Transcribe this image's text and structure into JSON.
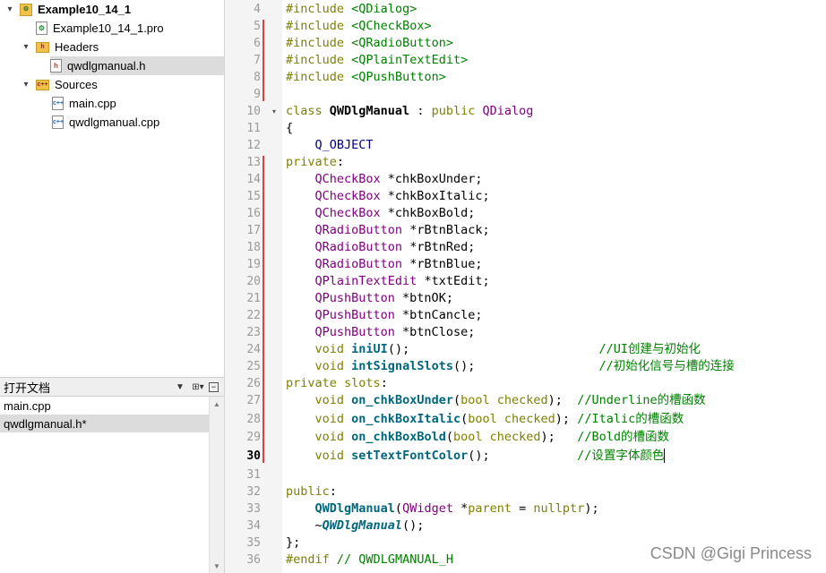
{
  "project_tree": {
    "items": [
      {
        "label": "Example10_14_1",
        "kind": "project",
        "expanded": true
      },
      {
        "label": "Example10_14_1.pro",
        "kind": "pro"
      },
      {
        "label": "Headers",
        "kind": "folder",
        "badge": "h",
        "expanded": true
      },
      {
        "label": "qwdlgmanual.h",
        "kind": "h",
        "selected": true
      },
      {
        "label": "Sources",
        "kind": "folder",
        "badge": "c++",
        "expanded": true
      },
      {
        "label": "main.cpp",
        "kind": "cpp"
      },
      {
        "label": "qwdlgmanual.cpp",
        "kind": "cpp"
      }
    ]
  },
  "open_documents": {
    "title": "打开文档",
    "icon_filter": "combo-arrow-icon",
    "icon_split": "split-icon",
    "icon_close": "close-icon",
    "items": [
      "main.cpp",
      "qwdlgmanual.h*"
    ],
    "selected_index": 1
  },
  "editor": {
    "current_line": 30,
    "lines": [
      {
        "n": 4,
        "code": "#include <QDialog>"
      },
      {
        "n": 5,
        "code": "#include <QCheckBox>"
      },
      {
        "n": 6,
        "code": "#include <QRadioButton>"
      },
      {
        "n": 7,
        "code": "#include <QPlainTextEdit>"
      },
      {
        "n": 8,
        "code": "#include <QPushButton>"
      },
      {
        "n": 9,
        "code": ""
      },
      {
        "n": 10,
        "code": "class QWDlgManual : public QDialog"
      },
      {
        "n": 11,
        "code": "{"
      },
      {
        "n": 12,
        "code": "    Q_OBJECT"
      },
      {
        "n": 13,
        "code": "private:"
      },
      {
        "n": 14,
        "code": "    QCheckBox *chkBoxUnder;"
      },
      {
        "n": 15,
        "code": "    QCheckBox *chkBoxItalic;"
      },
      {
        "n": 16,
        "code": "    QCheckBox *chkBoxBold;"
      },
      {
        "n": 17,
        "code": "    QRadioButton *rBtnBlack;"
      },
      {
        "n": 18,
        "code": "    QRadioButton *rBtnRed;"
      },
      {
        "n": 19,
        "code": "    QRadioButton *rBtnBlue;"
      },
      {
        "n": 20,
        "code": "    QPlainTextEdit *txtEdit;"
      },
      {
        "n": 21,
        "code": "    QPushButton *btnOK;"
      },
      {
        "n": 22,
        "code": "    QPushButton *btnCancle;"
      },
      {
        "n": 23,
        "code": "    QPushButton *btnClose;"
      },
      {
        "n": 24,
        "code": "    void iniUI();                          //UI创建与初始化"
      },
      {
        "n": 25,
        "code": "    void intSignalSlots();                 //初始化信号与槽的连接"
      },
      {
        "n": 26,
        "code": "private slots:"
      },
      {
        "n": 27,
        "code": "    void on_chkBoxUnder(bool checked);  //Underline的槽函数"
      },
      {
        "n": 28,
        "code": "    void on_chkBoxItalic(bool checked); //Italic的槽函数"
      },
      {
        "n": 29,
        "code": "    void on_chkBoxBold(bool checked);   //Bold的槽函数"
      },
      {
        "n": 30,
        "code": "    void setTextFontColor();            //设置字体颜色"
      },
      {
        "n": 31,
        "code": ""
      },
      {
        "n": 32,
        "code": "public:"
      },
      {
        "n": 33,
        "code": "    QWDlgManual(QWidget *parent = nullptr);"
      },
      {
        "n": 34,
        "code": "    ~QWDlgManual();"
      },
      {
        "n": 35,
        "code": "};"
      },
      {
        "n": 36,
        "code": "#endif // QWDLGMANUAL_H"
      }
    ]
  },
  "watermark": "CSDN @Gigi Princess",
  "colors": {
    "keyword": "#808000",
    "type": "#800080",
    "string": "#008000",
    "function": "#00677c",
    "comment": "#008000",
    "change_marker": "#e04040"
  }
}
